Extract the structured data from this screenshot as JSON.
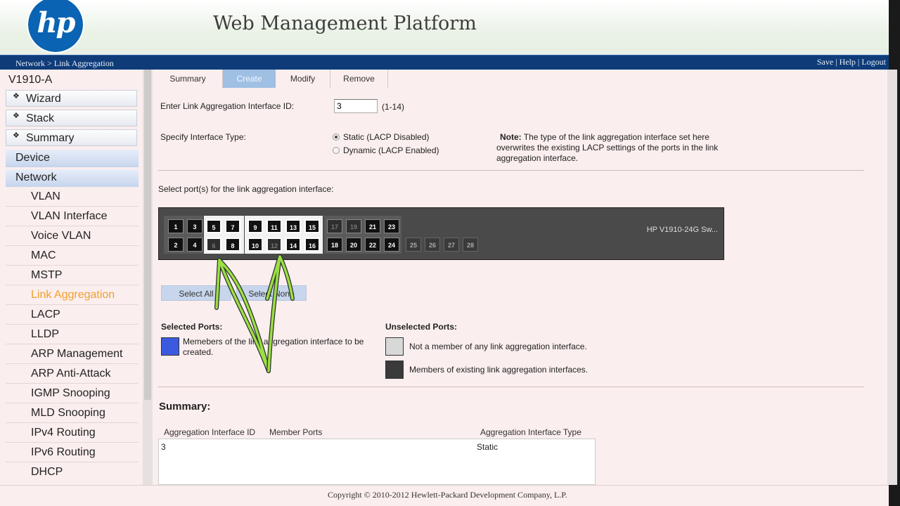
{
  "header": {
    "logo_text": "hp",
    "title": "Web Management Platform"
  },
  "navbar": {
    "breadcrumb": "Network > Link Aggregation",
    "links": [
      "Save",
      "Help",
      "Logout"
    ],
    "separator": " | "
  },
  "sidebar": {
    "device_name": "V1910-A",
    "top_items": [
      "Wizard",
      "Stack",
      "Summary"
    ],
    "groups": [
      "Device",
      "Network"
    ],
    "network_items": [
      "VLAN",
      "VLAN Interface",
      "Voice VLAN",
      "MAC",
      "MSTP",
      "Link Aggregation",
      "LACP",
      "LLDP",
      "ARP Management",
      "ARP Anti-Attack",
      "IGMP Snooping",
      "MLD Snooping",
      "IPv4 Routing",
      "IPv6 Routing",
      "DHCP"
    ],
    "active_item": "Link Aggregation"
  },
  "tabs": [
    "Summary",
    "Create",
    "Modify",
    "Remove"
  ],
  "active_tab": "Create",
  "form": {
    "id_label": "Enter Link Aggregation Interface ID:",
    "id_value": "3",
    "id_range": "(1-14)",
    "type_label": "Specify Interface Type:",
    "type_options": [
      "Static (LACP Disabled)",
      "Dynamic (LACP Enabled)"
    ],
    "type_selected": "Static (LACP Disabled)",
    "note_title": "Note:",
    "note_text": "The type of the link aggregation interface set here overwrites the existing LACP settings of the ports in the link aggregation interface."
  },
  "ports": {
    "select_label": "Select port(s) for the link aggregation interface:",
    "switch_model": "HP V1910-24G Sw...",
    "top_row": [
      "1",
      "3",
      "5",
      "7",
      "9",
      "11",
      "13",
      "15",
      "17",
      "19",
      "21",
      "23"
    ],
    "bottom_row": [
      "2",
      "4",
      "6",
      "8",
      "10",
      "12",
      "14",
      "16",
      "18",
      "20",
      "22",
      "24"
    ],
    "extra_ports": [
      "25",
      "26",
      "27",
      "28"
    ],
    "selected": [
      "5",
      "6",
      "7",
      "8",
      "9",
      "10",
      "11",
      "12",
      "13",
      "14",
      "15",
      "16"
    ],
    "select_all_label": "Select All",
    "select_none_label": "Select None"
  },
  "legend": {
    "selected_title": "Selected Ports:",
    "selected_desc": "Memebers of the link aggregation interface to be created.",
    "unselected_title": "Unselected Ports:",
    "not_member_desc": "Not a member of any link aggregation interface.",
    "existing_desc": "Members of existing link aggregation interfaces.",
    "colors": {
      "selected": "#3c5ae0",
      "not_member": "#d8d8d8",
      "existing": "#3a3a3a"
    }
  },
  "summary": {
    "title": "Summary:",
    "columns": [
      "Aggregation Interface ID",
      "Member Ports",
      "Aggregation Interface Type"
    ],
    "rows": [
      [
        "3",
        "",
        "Static"
      ]
    ]
  },
  "footer": "Copyright © 2010-2012 Hewlett-Packard Development Company, L.P."
}
